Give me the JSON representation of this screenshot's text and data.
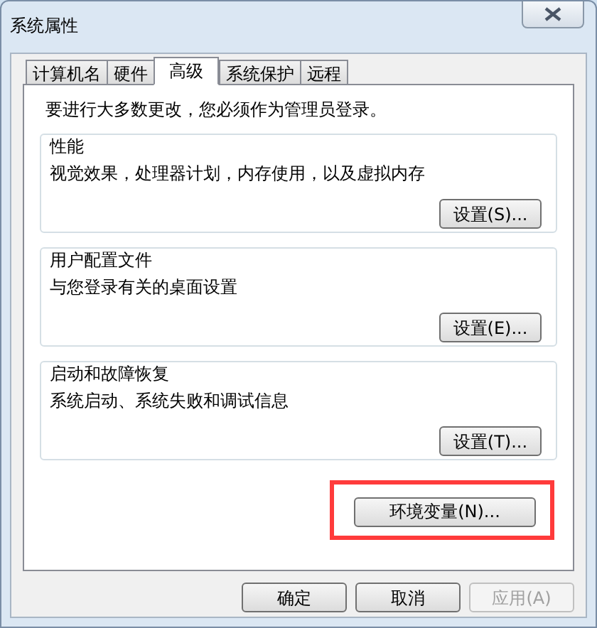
{
  "window": {
    "title": "系统属性"
  },
  "tabs": [
    {
      "label": "计算机名",
      "selected": false
    },
    {
      "label": "硬件",
      "selected": false
    },
    {
      "label": "高级",
      "selected": true
    },
    {
      "label": "系统保护",
      "selected": false
    },
    {
      "label": "远程",
      "selected": false
    }
  ],
  "admin_note": "要进行大多数更改，您必须作为管理员登录。",
  "groups": [
    {
      "title": "性能",
      "description": "视觉效果，处理器计划，内存使用，以及虚拟内存",
      "button": "设置(S)..."
    },
    {
      "title": "用户配置文件",
      "description": "与您登录有关的桌面设置",
      "button": "设置(E)..."
    },
    {
      "title": "启动和故障恢复",
      "description": "系统启动、系统失败和调试信息",
      "button": "设置(T)..."
    }
  ],
  "env_button": {
    "label": "环境变量(N)...",
    "highlighted": true
  },
  "buttons": [
    {
      "label": "确定",
      "disabled": false
    },
    {
      "label": "取消",
      "disabled": false
    },
    {
      "label": "应用(A)",
      "disabled": true
    }
  ]
}
